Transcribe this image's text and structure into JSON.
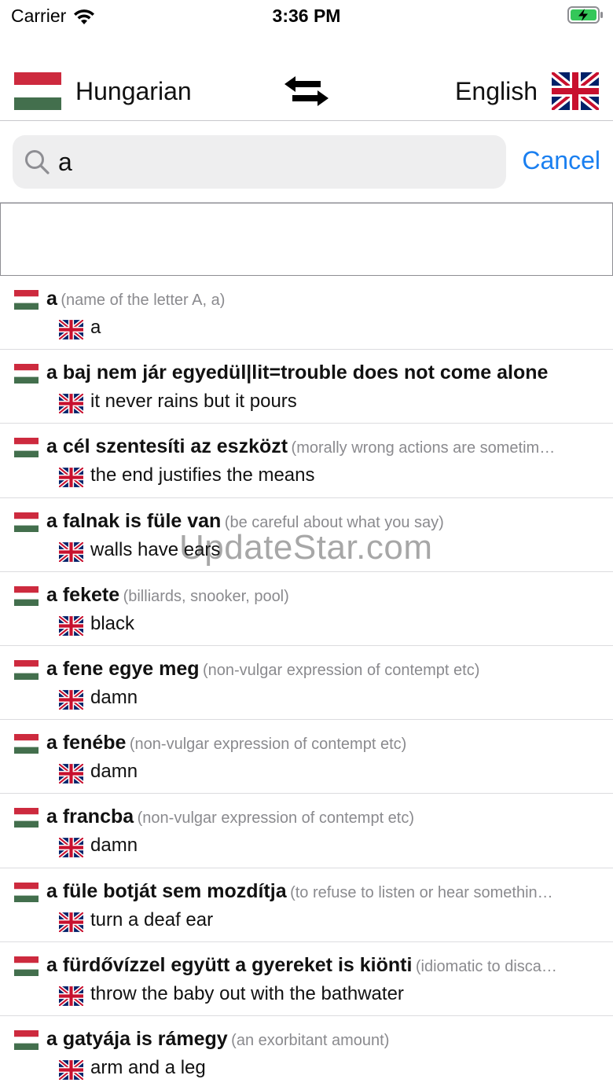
{
  "status_bar": {
    "carrier": "Carrier",
    "time": "3:36 PM"
  },
  "language_bar": {
    "source": "Hungarian",
    "target": "English"
  },
  "search": {
    "value": "a",
    "cancel_label": "Cancel"
  },
  "colors": {
    "accent": "#1a7ff0",
    "hu_red": "#cd2a3e",
    "hu_green": "#436f4d",
    "uk_blue": "#012169",
    "uk_red": "#c8102e"
  },
  "results": [
    {
      "term": "a",
      "note": "(name of the letter A, a)",
      "translation": "a"
    },
    {
      "term": "a baj nem jár egyedül|lit=trouble does not come alone",
      "note": "",
      "translation": "it never rains but it pours"
    },
    {
      "term": "a cél szentesíti az eszközt",
      "note": "(morally wrong actions are sometim…",
      "translation": "the end justifies the means"
    },
    {
      "term": "a falnak is füle van",
      "note": "(be careful about what you say)",
      "translation": "walls have ears"
    },
    {
      "term": "a fekete",
      "note": "(billiards, snooker, pool)",
      "translation": "black"
    },
    {
      "term": "a fene egye meg",
      "note": "(non-vulgar expression of contempt etc)",
      "translation": "damn"
    },
    {
      "term": "a fenébe",
      "note": "(non-vulgar expression of contempt etc)",
      "translation": "damn"
    },
    {
      "term": "a francba",
      "note": "(non-vulgar expression of contempt etc)",
      "translation": "damn"
    },
    {
      "term": "a füle botját sem mozdítja",
      "note": "(to refuse to listen or hear somethin…",
      "translation": "turn a deaf ear"
    },
    {
      "term": "a fürdővízzel együtt a gyereket is kiönti",
      "note": "(idiomatic to disca…",
      "translation": "throw the baby out with the bathwater"
    },
    {
      "term": "a gatyája is rámegy",
      "note": "(an exorbitant amount)",
      "translation": "arm and a leg"
    }
  ],
  "watermark": "UpdateStar.com"
}
